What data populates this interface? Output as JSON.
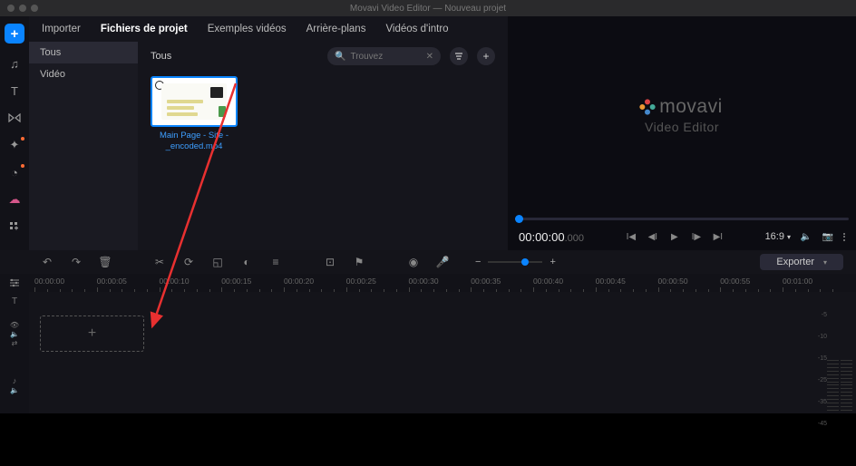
{
  "window": {
    "title": "Movavi Video Editor — Nouveau projet"
  },
  "tabs": [
    "Importer",
    "Fichiers de projet",
    "Exemples vidéos",
    "Arrière-plans",
    "Vidéos d'intro"
  ],
  "active_tab": 1,
  "categories": {
    "items": [
      "Tous",
      "Vidéo"
    ],
    "selected": 0
  },
  "browser": {
    "heading": "Tous",
    "search_placeholder": "Trouvez",
    "clip": {
      "line1": "Main Page - Site -",
      "line2": "_encoded.mp4"
    }
  },
  "preview": {
    "brand": "movavi",
    "subtitle": "Video Editor",
    "timecode": "00:00:00",
    "timecode_ms": ".000",
    "aspect": "16:9"
  },
  "timeline": {
    "export_label": "Exporter",
    "ruler": [
      "00:00:00",
      "00:00:05",
      "00:00:10",
      "00:00:15",
      "00:00:20",
      "00:00:25",
      "00:00:30",
      "00:00:35",
      "00:00:40",
      "00:00:45",
      "00:00:50",
      "00:00:55",
      "00:01:00"
    ],
    "meter_labels": [
      "-5",
      "-10",
      "-15",
      "-25",
      "-35",
      "-45"
    ]
  }
}
